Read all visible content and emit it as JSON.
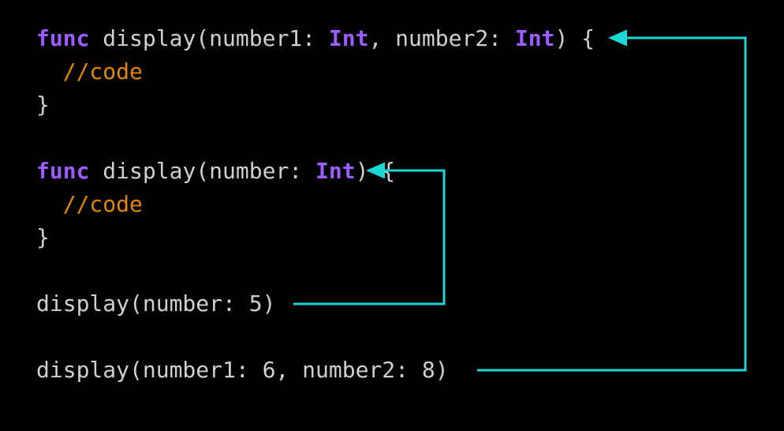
{
  "code": {
    "l1_kw": "func",
    "l1_a": " display(number1: ",
    "l1_t1": "Int",
    "l1_b": ", number2: ",
    "l1_t2": "Int",
    "l1_c": ") {",
    "l2": "  //code",
    "l3": "}",
    "l5_kw": "func",
    "l5_a": " display(number: ",
    "l5_t": "Int",
    "l5_b": ") {",
    "l6": "  //code",
    "l7": "}",
    "l9": "display(number: 5)",
    "l11": "display(number1: 6, number2: 8)"
  },
  "colors": {
    "keyword": "#9d5cff",
    "type": "#9d5cff",
    "comment": "#e08800",
    "text": "#d0d0d0",
    "bg": "#000000",
    "arrow": "#1dd6d6"
  }
}
